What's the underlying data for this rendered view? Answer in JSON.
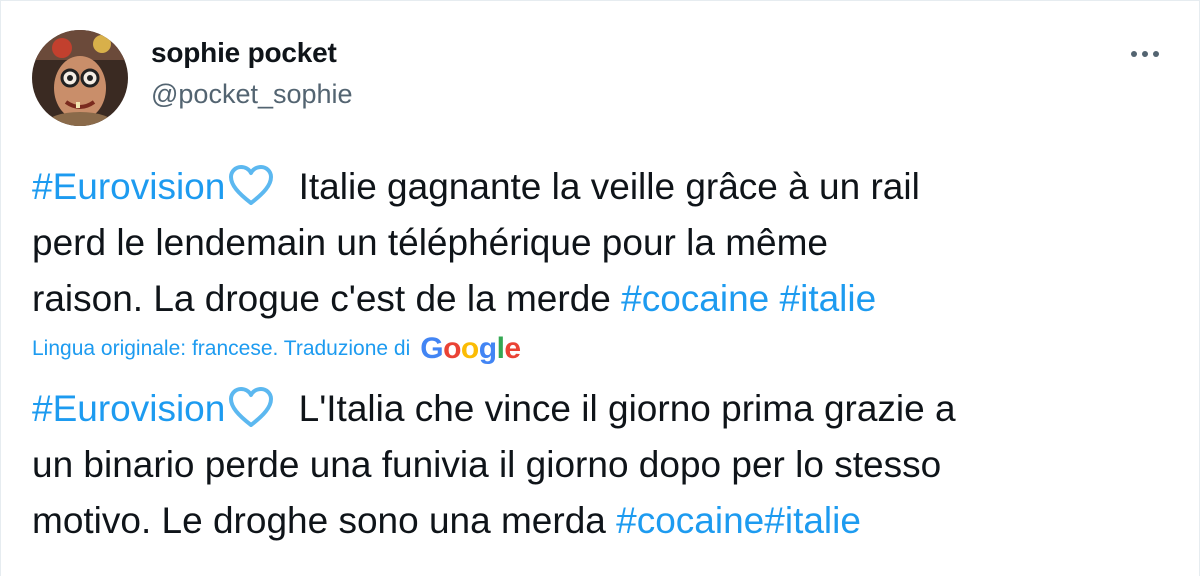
{
  "author": {
    "name": "sophie pocket",
    "handle": "@pocket_sophie"
  },
  "menu": {
    "icon": "more-horizontal-icon",
    "label": "···"
  },
  "tweet": {
    "original_lines": [
      {
        "hashtag": "#Eurovision",
        "emoji": "light-blue-heart-emoji",
        "text": " Italie gagnante la veille grâce à un rail"
      },
      {
        "text": "perd le lendemain un téléphérique pour la même"
      },
      {
        "text": "raison. La drogue c'est de la merde ",
        "tags": [
          "#cocaine",
          "#italie"
        ]
      }
    ],
    "translation_note": "Lingua originale: francese. Traduzione di",
    "translation_provider": "Google",
    "translated_lines": [
      {
        "hashtag": "#Eurovision",
        "emoji": "light-blue-heart-emoji",
        "text": " L'Italia che vince il giorno prima grazie a"
      },
      {
        "text": "un binario perde una funivia il giorno dopo per lo stesso"
      },
      {
        "text": "motivo. Le droghe sono una merda ",
        "tags": [
          "#cocaine#italie"
        ]
      }
    ]
  },
  "colors": {
    "link": "#1d9bf0",
    "text": "#0f1419",
    "secondary": "#536471",
    "heart": "#5cb8f0"
  }
}
